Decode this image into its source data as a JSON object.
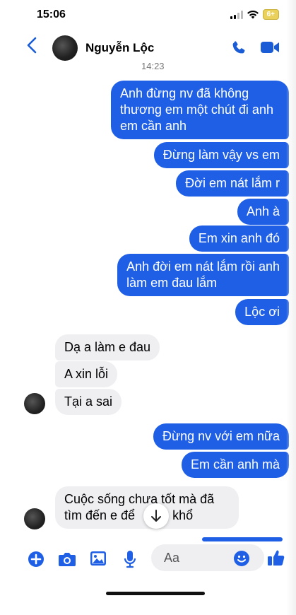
{
  "status": {
    "time": "15:06",
    "battery": "6+"
  },
  "header": {
    "contact_name": "Nguyễn Lộc"
  },
  "thread": {
    "timestamp": "14:23",
    "outgoing_1": [
      "Anh đừng nv đã không",
      "thương em một chút đi anh",
      "em cần anh"
    ],
    "outgoing_2": "Đừng làm vậy vs em",
    "outgoing_3": "Đời em nát lắm r",
    "outgoing_4": "Anh à",
    "outgoing_5": "Em xin anh đó",
    "outgoing_6": [
      "Anh đời em nát lắm rồi anh",
      "làm em đau lắm"
    ],
    "outgoing_7": "Lộc ơi",
    "incoming_1": "Dạ a làm e đau",
    "incoming_2": "A xin lỗi",
    "incoming_3": "Tại a sai",
    "outgoing_8": "Đừng nv với em nữa",
    "outgoing_9": "Em cần anh mà",
    "incoming_4": [
      "Cuộc sống chưa tốt mà đã",
      "tìm đến e để",
      "e khổ"
    ]
  },
  "composer": {
    "placeholder": "Aa"
  },
  "colors": {
    "accent": "#1f5fe6",
    "incoming_bubble": "#efeff2"
  },
  "icons": [
    "chevron-left-icon",
    "phone-icon",
    "video-camera-icon",
    "plus-icon",
    "camera-icon",
    "image-icon",
    "microphone-icon",
    "emoji-icon",
    "thumbs-up-icon",
    "arrow-down-icon"
  ]
}
